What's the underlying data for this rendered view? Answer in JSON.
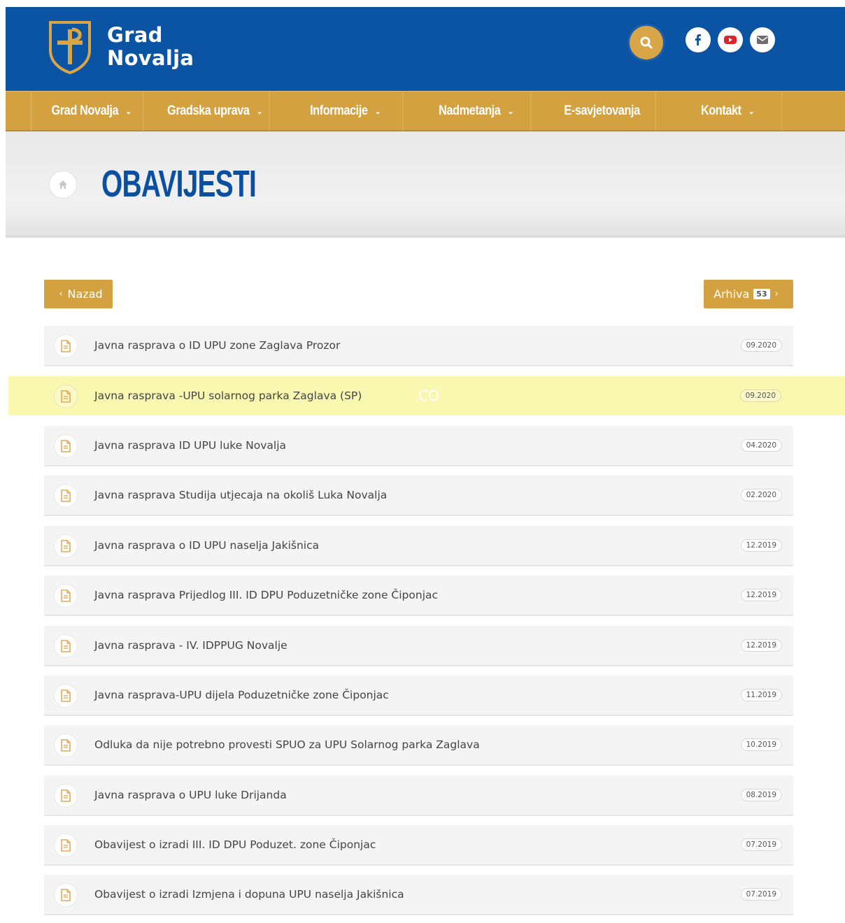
{
  "site": {
    "name_line1": "Grad",
    "name_line2": "Novalja",
    "brand_blue": "#0b53a3",
    "brand_gold": "#d3a13f",
    "icons": [
      "shield-logo-icon",
      "search-icon",
      "facebook-icon",
      "youtube-icon",
      "email-icon"
    ]
  },
  "nav": {
    "items": [
      {
        "label": "Grad Novalja",
        "has_dropdown": true
      },
      {
        "label": "Gradska uprava",
        "has_dropdown": true
      },
      {
        "label": "Informacije",
        "has_dropdown": true
      },
      {
        "label": "Nadmetanja",
        "has_dropdown": true
      },
      {
        "label": "E-savjetovanja",
        "has_dropdown": false
      },
      {
        "label": "Kontakt",
        "has_dropdown": true
      }
    ]
  },
  "page": {
    "title": "OBAVIJESTI"
  },
  "buttons": {
    "back_label": "Nazad",
    "archive_label": "Arhiva",
    "archive_count": "53"
  },
  "highlight_mark": "CO",
  "list": [
    {
      "title": "Javna rasprava o ID UPU zone Zaglava Prozor",
      "date": "09.2020"
    },
    {
      "title": "Javna rasprava -UPU solarnog parka Zaglava (SP)",
      "date": "09.2020"
    },
    {
      "title": "Javna rasprava ID UPU luke Novalja",
      "date": "04.2020"
    },
    {
      "title": "Javna rasprava Studija utjecaja na okoliš Luka Novalja",
      "date": "02.2020"
    },
    {
      "title": "Javna rasprava o ID UPU naselja Jakišnica",
      "date": "12.2019"
    },
    {
      "title": "Javna rasprava Prijedlog III. ID DPU Poduzetničke zone Čiponjac",
      "date": "12.2019"
    },
    {
      "title": "Javna rasprava - IV. IDPPUG Novalje",
      "date": "12.2019"
    },
    {
      "title": "Javna rasprava-UPU dijela Poduzetničke zone Čiponjac",
      "date": "11.2019"
    },
    {
      "title": "Odluka da nije potrebno provesti SPUO za UPU Solarnog parka Zaglava",
      "date": "10.2019"
    },
    {
      "title": "Javna rasprava o UPU luke Drijanda",
      "date": "08.2019"
    },
    {
      "title": "Obavijest o izradi III. ID DPU Poduzet. zone Čiponjac",
      "date": "07.2019"
    },
    {
      "title": "Obavijest o izradi Izmjena i dopuna UPU naselja Jakišnica",
      "date": "07.2019"
    }
  ]
}
